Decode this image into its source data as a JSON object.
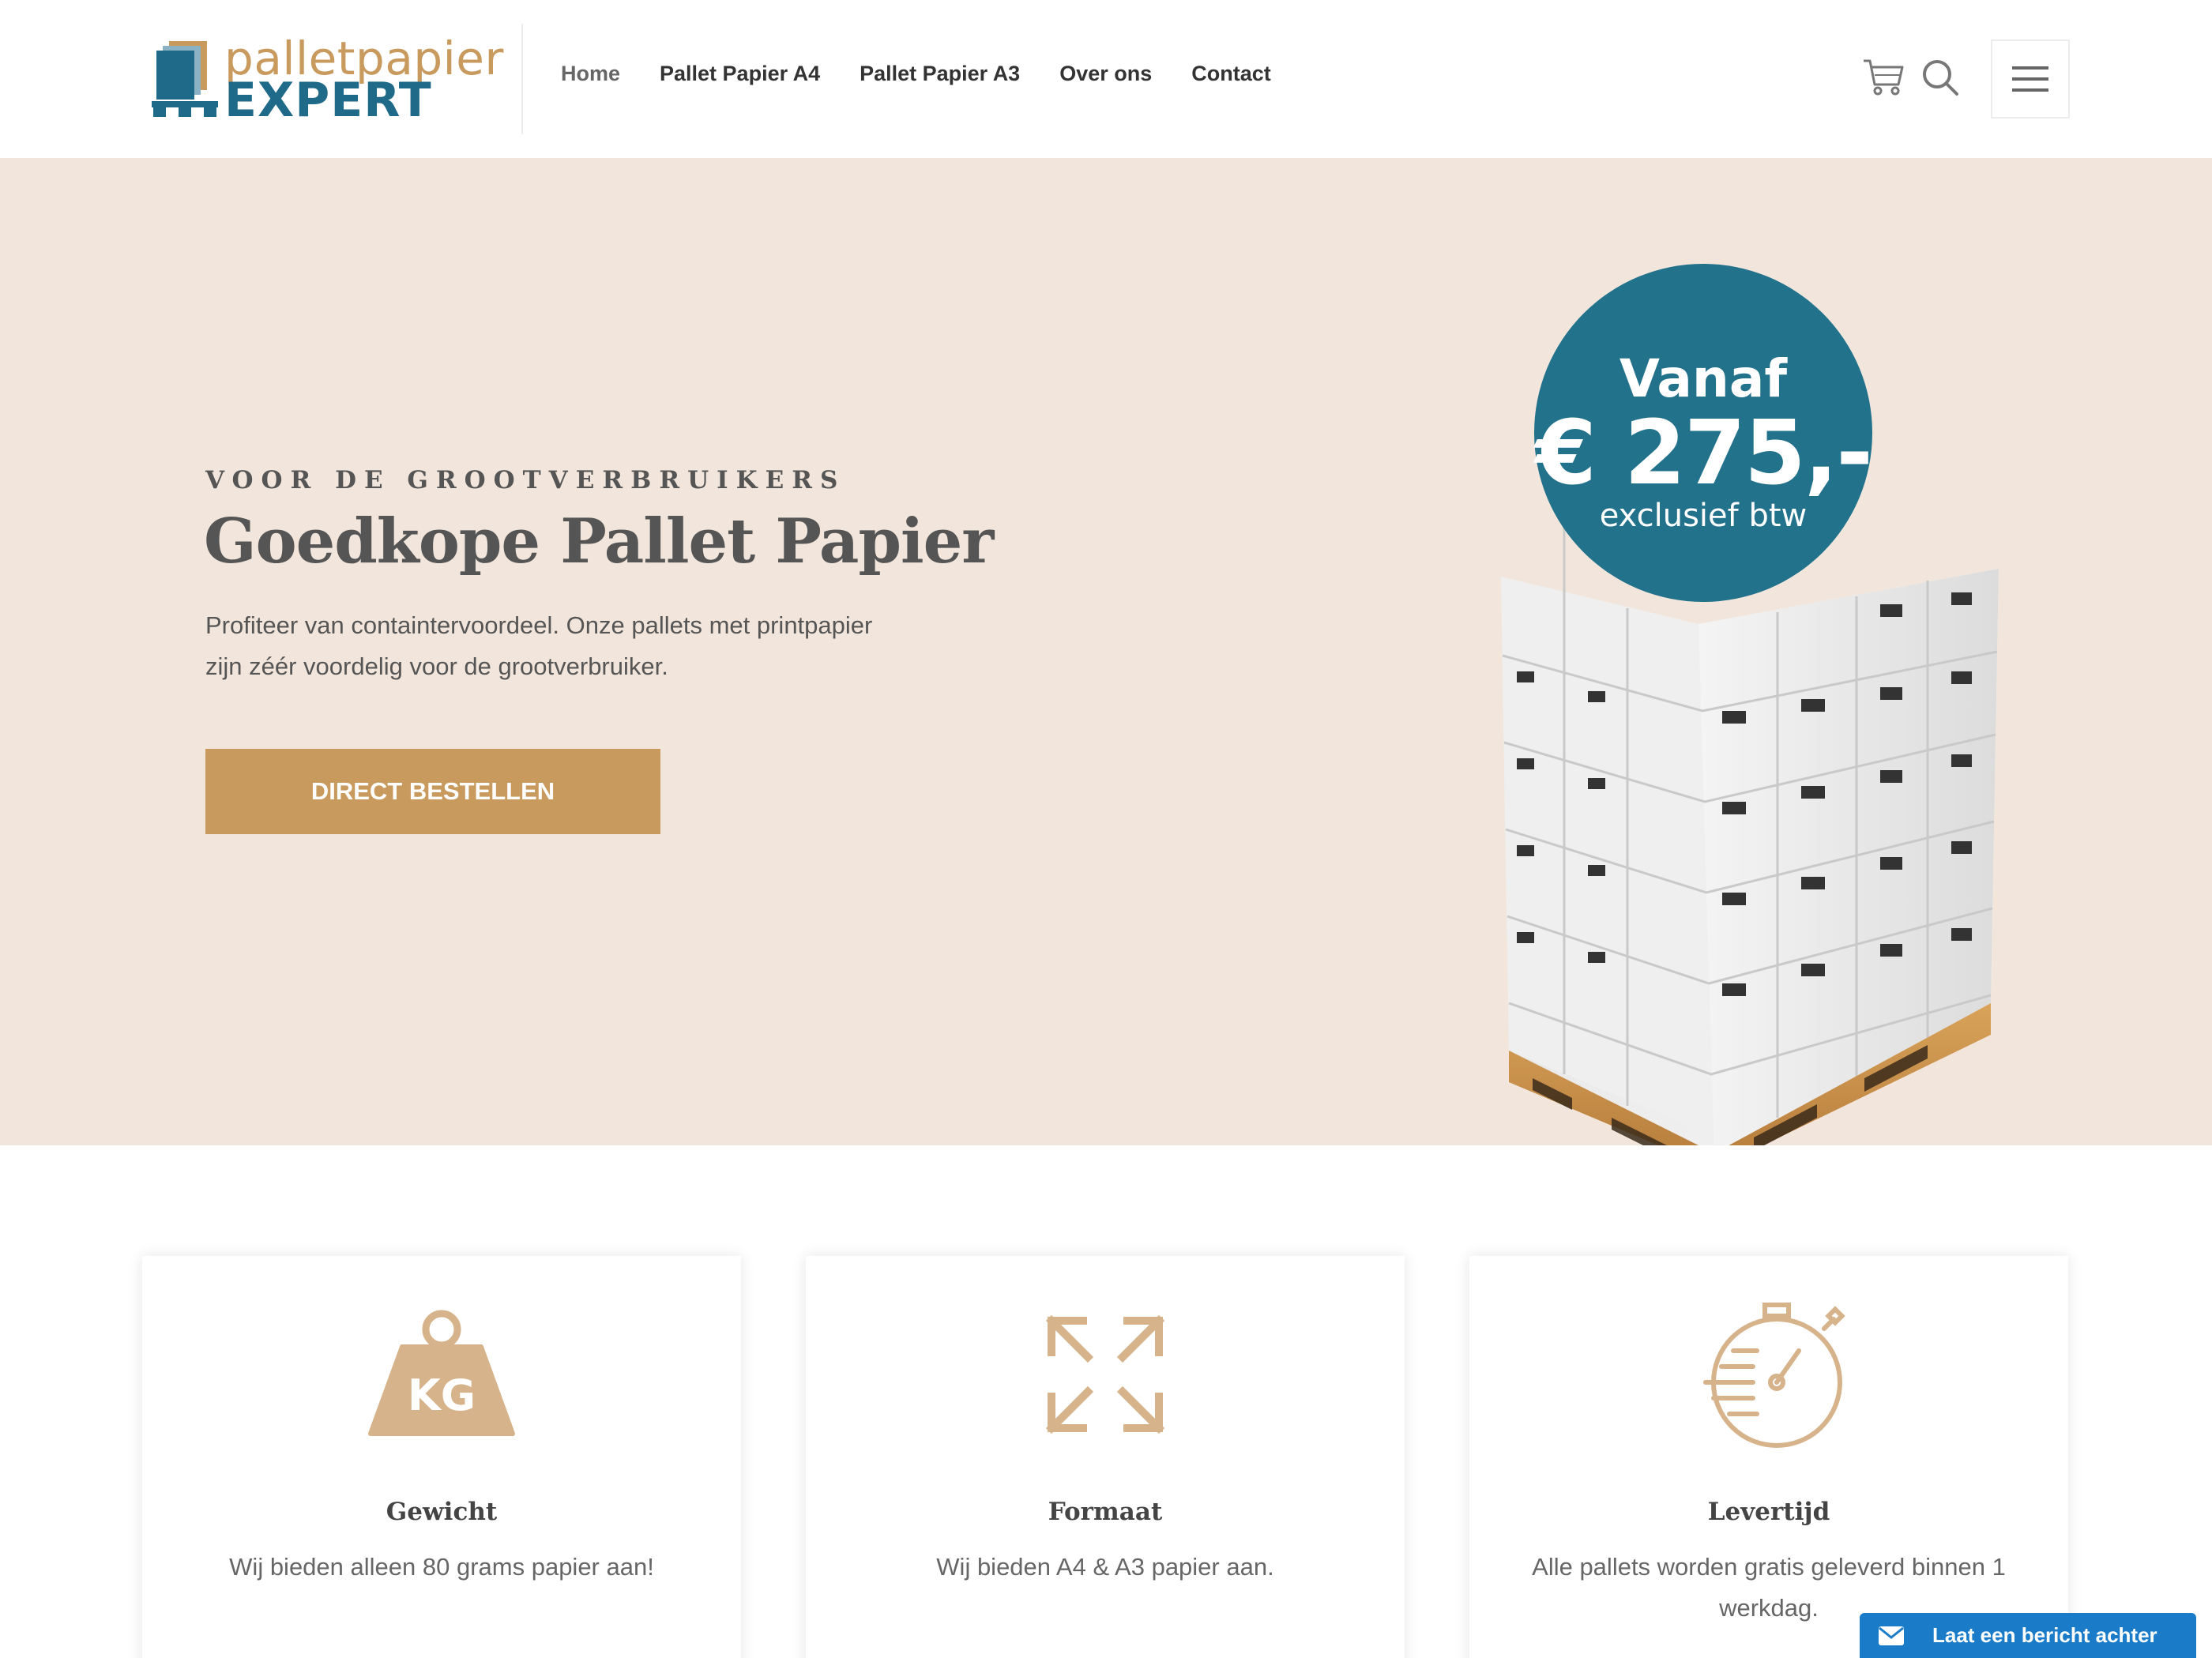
{
  "header": {
    "logo": {
      "line1": "palletpapier",
      "line2": "EXPERT"
    },
    "nav": [
      {
        "label": "Home"
      },
      {
        "label": "Pallet Papier A4"
      },
      {
        "label": "Pallet Papier A3"
      },
      {
        "label": "Over ons"
      },
      {
        "label": "Contact"
      }
    ],
    "icons": [
      "cart-icon",
      "search-icon",
      "hamburger-menu-icon"
    ]
  },
  "hero": {
    "eyebrow": "VOOR DE GROOTVERBRUIKERS",
    "title": "Goedkope Pallet Papier",
    "text": "Profiteer van containtervoordeel. Onze pallets met printpapier zijn zéér voordelig voor de grootverbruiker.",
    "cta": "DIRECT BESTELLEN",
    "badge": {
      "line1": "Vanaf",
      "price": "€ 275,-",
      "note": "exclusief btw"
    }
  },
  "features": [
    {
      "icon": "weight-kg-icon",
      "icon_text": "KG",
      "title": "Gewicht",
      "text": "Wij bieden alleen 80 grams papier aan!"
    },
    {
      "icon": "expand-arrows-icon",
      "title": "Formaat",
      "text": "Wij bieden A4 & A3 papier aan."
    },
    {
      "icon": "stopwatch-icon",
      "title": "Levertijd",
      "text": "Alle pallets worden gratis geleverd binnen 1 werkdag."
    }
  ],
  "chat": {
    "label": "Laat een bericht achter",
    "icon": "mail-icon"
  },
  "colors": {
    "brand_gold": "#c99a5e",
    "brand_blue": "#22728c",
    "hero_bg": "#f2e6dc",
    "chat_blue": "#1a7bc9"
  }
}
